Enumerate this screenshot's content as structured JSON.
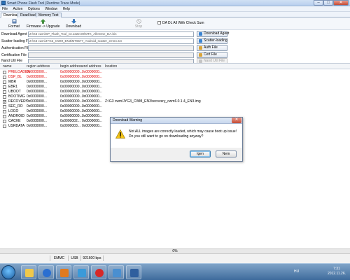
{
  "window": {
    "title": "Smart Phone Flash Tool (Runtime Trace Mode)",
    "min": "–",
    "max": "□",
    "close": "✕"
  },
  "menu": [
    "File",
    "Action",
    "Options",
    "Window",
    "Help"
  ],
  "tabs": [
    "Download",
    "Read back",
    "Memory Test"
  ],
  "toolbar": {
    "format": "Format",
    "firmware_upgrade": "Firmware -> Upgrade",
    "download": "Download",
    "stop": "Stop",
    "da_checksum": "DA DL All With Check Sum"
  },
  "files": {
    "download_agent": {
      "label": "Download Agent",
      "path": "Z:\\G3 cwm\\SP_Flash_Tool_v3.1222.00\\MTK_AllInOne_DA.bin",
      "button": "Download Agent"
    },
    "scatter": {
      "label": "Scatter-loading File",
      "path": "Z:\\G3 cwm\\JYG3_CWM_EN3\\MT6577_Android_scatter_emmc.txt",
      "button": "Scatter-loading"
    },
    "auth": {
      "label": "Authentication File",
      "path": "",
      "button": "Auth File"
    },
    "cert": {
      "label": "Certification File",
      "path": "",
      "button": "Cert File"
    },
    "nand": {
      "label": "Nand Util File",
      "path": "",
      "button": "Nand Util File"
    }
  },
  "grid": {
    "headers": [
      "name",
      "region address",
      "begin address",
      "end address",
      "location"
    ],
    "rows": [
      {
        "name": "PRELOADER",
        "region": "0x0000000...",
        "begin": "0x00000000...",
        "end": "0x0000000...",
        "location": "",
        "checked": false,
        "red": true
      },
      {
        "name": "DSP_BL",
        "region": "0x0000000...",
        "begin": "0x00000000...",
        "end": "0x0000000...",
        "location": "",
        "checked": false,
        "red": true
      },
      {
        "name": "MBR",
        "region": "0x0000000...",
        "begin": "0x00000000...",
        "end": "0x0000000...",
        "location": "",
        "checked": false,
        "red": false
      },
      {
        "name": "EBR1",
        "region": "0x0000000...",
        "begin": "0x00000000...",
        "end": "0x0000000...",
        "location": "",
        "checked": false,
        "red": false
      },
      {
        "name": "UBOOT",
        "region": "0x0000000...",
        "begin": "0x00000000...",
        "end": "0x0000000...",
        "location": "",
        "checked": false,
        "red": false
      },
      {
        "name": "BOOTIMG",
        "region": "0x0000000...",
        "begin": "0x00000000...",
        "end": "0x0000000...",
        "location": "",
        "checked": false,
        "red": false
      },
      {
        "name": "RECOVERY",
        "region": "0x0000000...",
        "begin": "0x00000000...",
        "end": "0x0000000...",
        "location": "Z:\\G3 cwm\\JYG3_CWM_EN3\\recovery_cwm6.0.1.4_EN3.img",
        "checked": true,
        "red": false
      },
      {
        "name": "SEC_RO",
        "region": "0x0000000...",
        "begin": "0x00000000...",
        "end": "0x0000000...",
        "location": "",
        "checked": false,
        "red": false
      },
      {
        "name": "LOGO",
        "region": "0x0000000...",
        "begin": "0x00000000...",
        "end": "0x0000000...",
        "location": "",
        "checked": false,
        "red": false
      },
      {
        "name": "ANDROID",
        "region": "0x0000000...",
        "begin": "0x00000000...",
        "end": "0x0000000...",
        "location": "",
        "checked": false,
        "red": false
      },
      {
        "name": "CACHE",
        "region": "0x0000000...",
        "begin": "0x0000002...",
        "end": "0x0000000...",
        "location": "",
        "checked": false,
        "red": false
      },
      {
        "name": "USRDATA",
        "region": "0x0000000...",
        "begin": "0x0000003...",
        "end": "0x0000000...",
        "location": "",
        "checked": false,
        "red": false
      }
    ]
  },
  "status": {
    "progress": "0%",
    "storage": "EMMC",
    "port": "USB",
    "baud": "921600 bps"
  },
  "dialog": {
    "title": "Download Warning",
    "line1": "Not ALL images are correctly loaded, which may cause boot up issue!",
    "line2": "Do you still want to go on downloading anyway?",
    "yes": "Igen",
    "no": "Nem"
  },
  "taskbar": {
    "lang": "HU",
    "time": "7:31",
    "date": "2012.11.26."
  },
  "colors": {
    "accent": "#2a6fb5",
    "error": "#e00000"
  }
}
